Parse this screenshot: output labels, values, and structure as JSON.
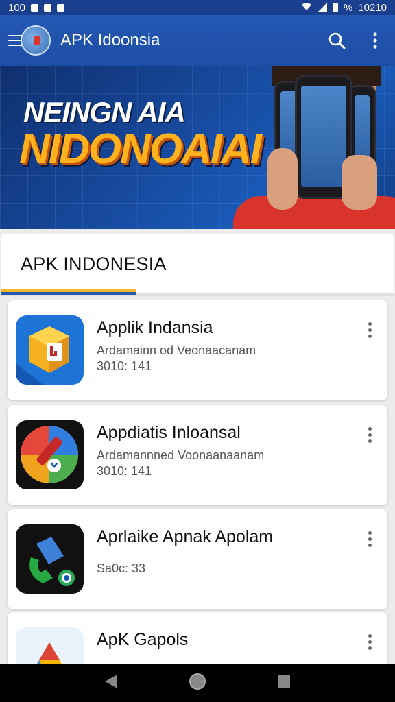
{
  "status_bar": {
    "left_text": "100",
    "battery": "%",
    "time": "10210"
  },
  "app_bar": {
    "title": "APK Idoonsia",
    "logo_icon": "globe-map-icon",
    "actions": [
      "search-icon",
      "more-vert-icon"
    ]
  },
  "banner": {
    "line1": "NEINGN AIA",
    "line2": "NIDONOAIAI"
  },
  "section": {
    "title": "APK INDONESIA"
  },
  "apps": [
    {
      "name": "Applik Indansia",
      "description": "Ardamainn od Veonaacanam",
      "size": "3010: 141",
      "icon": "app-icon-cube"
    },
    {
      "name": "Appdiatis Inloansal",
      "description": "Ardamannned Voonaanaanam",
      "size": "3010: 141",
      "icon": "app-icon-compass"
    },
    {
      "name": "Aprlaike Apnak Apolam",
      "description": "",
      "size": "Sa0c: 33",
      "icon": "app-icon-phone"
    },
    {
      "name": "ApK Gapols",
      "description": "",
      "size": "",
      "icon": "app-icon-triangle"
    }
  ],
  "colors": {
    "app_bar": "#1d4ea6",
    "accent_yellow": "#f3b52b",
    "accent_blue": "#2258b0"
  },
  "nav_bar": [
    "back-icon",
    "home-icon",
    "recents-icon"
  ]
}
